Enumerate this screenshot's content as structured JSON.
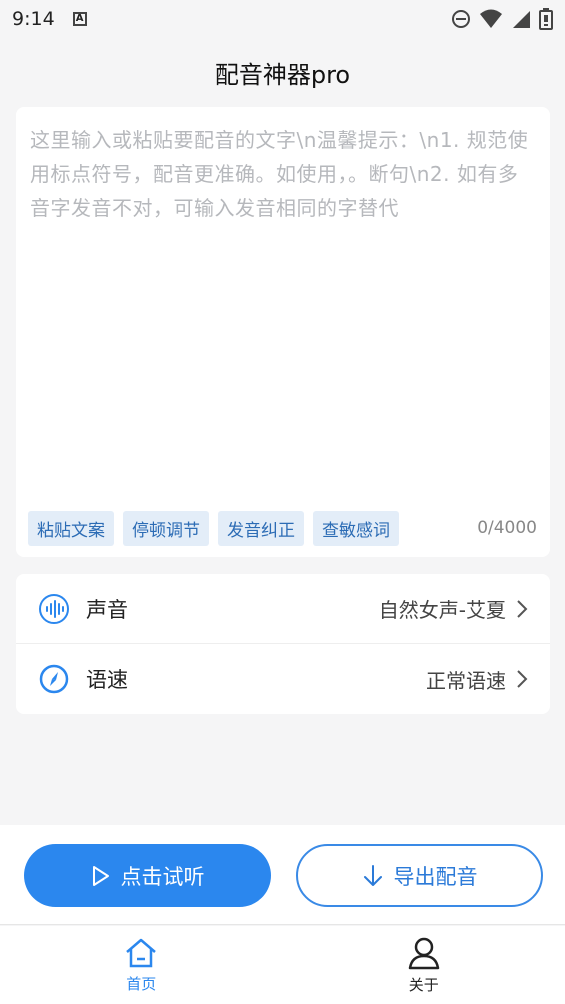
{
  "status_bar": {
    "time": "9:14",
    "icons": [
      "a-notification-icon",
      "do-not-disturb-icon",
      "wifi-icon",
      "signal-icon",
      "battery-icon"
    ]
  },
  "app": {
    "title": "配音神器pro"
  },
  "editor": {
    "placeholder": "这里输入或粘贴要配音的文字\\n温馨提示：\\n1. 规范使用标点符号，配音更准确。如使用，。断句\\n2. 如有多音字发音不对，可输入发音相同的字替代",
    "char_count": "0/4000",
    "chips": [
      "粘贴文案",
      "停顿调节",
      "发音纠正",
      "查敏感词"
    ]
  },
  "settings": {
    "voice": {
      "label": "声音",
      "value": "自然女声-艾夏",
      "icon": "sound-wave-icon"
    },
    "speed": {
      "label": "语速",
      "value": "正常语速",
      "icon": "speedometer-icon"
    }
  },
  "actions": {
    "listen_label": "点击试听",
    "export_label": "导出配音"
  },
  "tabs": [
    {
      "label": "首页",
      "icon": "home-icon",
      "active": true
    },
    {
      "label": "关于",
      "icon": "user-icon",
      "active": false
    }
  ],
  "colors": {
    "accent": "#2b87ee",
    "chip_bg": "#e3edf8",
    "chip_text": "#2c6cb5",
    "page_bg": "#f5f5f6",
    "placeholder_text": "#b6b8bc"
  }
}
